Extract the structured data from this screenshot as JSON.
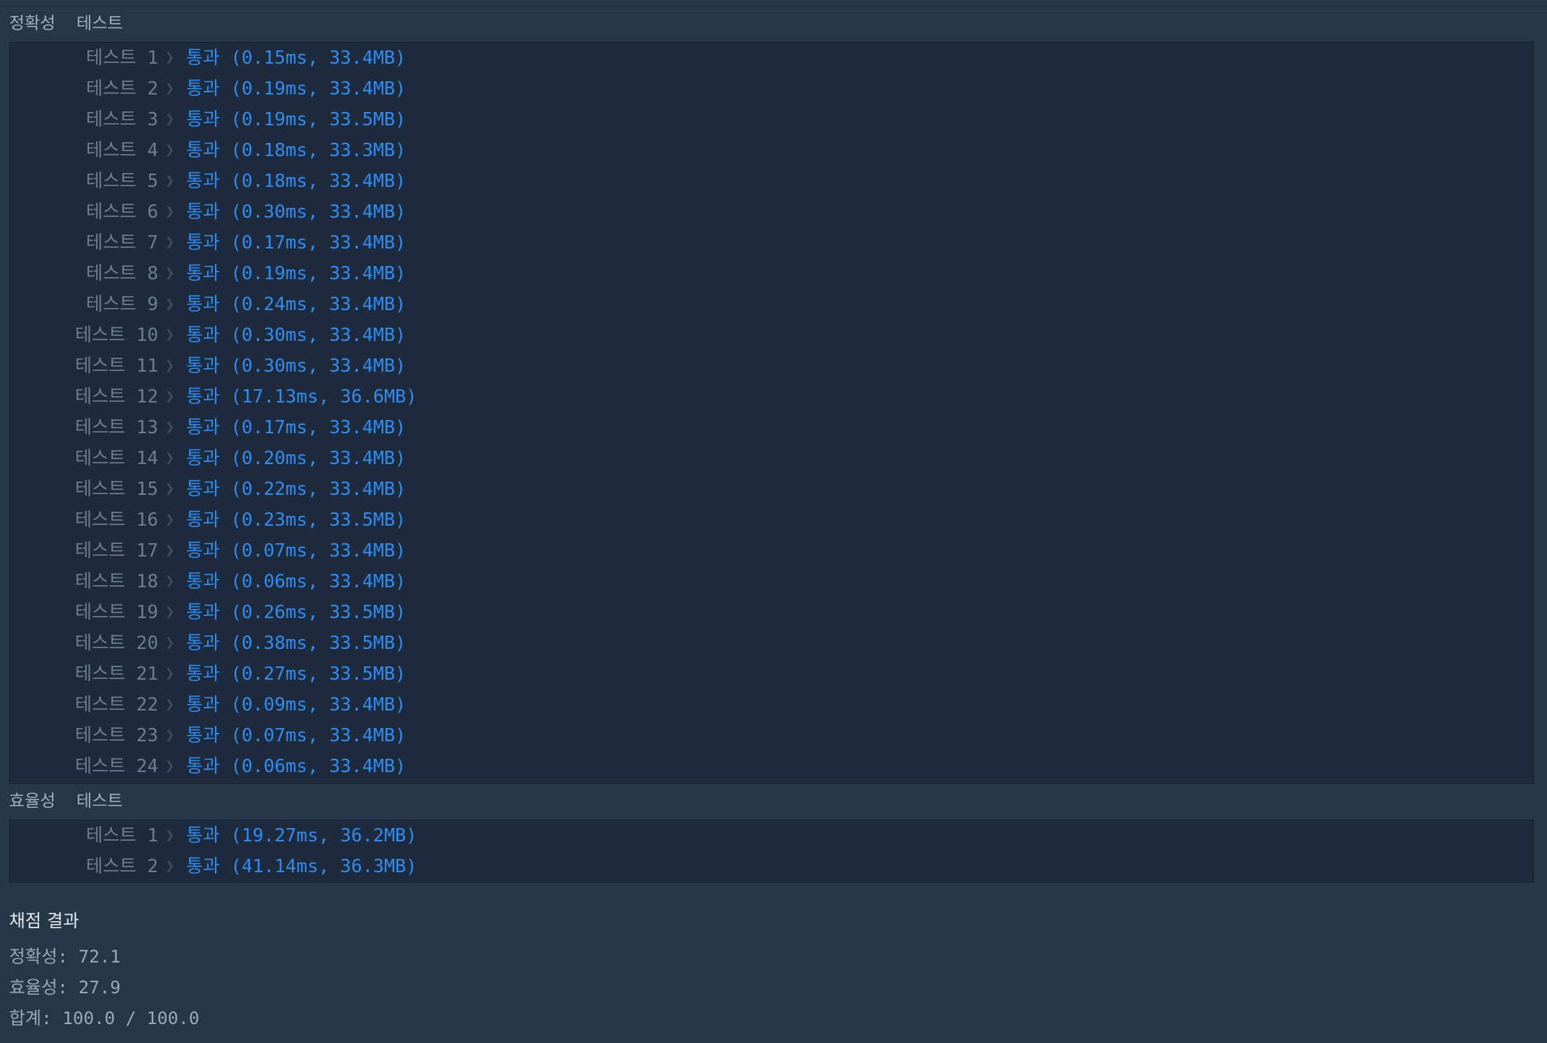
{
  "accuracy_section": {
    "title_part1": "정확성",
    "title_part2": "테스트",
    "rows": [
      {
        "label": "테스트 1",
        "result": "통과 (0.15ms, 33.4MB)"
      },
      {
        "label": "테스트 2",
        "result": "통과 (0.19ms, 33.4MB)"
      },
      {
        "label": "테스트 3",
        "result": "통과 (0.19ms, 33.5MB)"
      },
      {
        "label": "테스트 4",
        "result": "통과 (0.18ms, 33.3MB)"
      },
      {
        "label": "테스트 5",
        "result": "통과 (0.18ms, 33.4MB)"
      },
      {
        "label": "테스트 6",
        "result": "통과 (0.30ms, 33.4MB)"
      },
      {
        "label": "테스트 7",
        "result": "통과 (0.17ms, 33.4MB)"
      },
      {
        "label": "테스트 8",
        "result": "통과 (0.19ms, 33.4MB)"
      },
      {
        "label": "테스트 9",
        "result": "통과 (0.24ms, 33.4MB)"
      },
      {
        "label": "테스트 10",
        "result": "통과 (0.30ms, 33.4MB)"
      },
      {
        "label": "테스트 11",
        "result": "통과 (0.30ms, 33.4MB)"
      },
      {
        "label": "테스트 12",
        "result": "통과 (17.13ms, 36.6MB)"
      },
      {
        "label": "테스트 13",
        "result": "통과 (0.17ms, 33.4MB)"
      },
      {
        "label": "테스트 14",
        "result": "통과 (0.20ms, 33.4MB)"
      },
      {
        "label": "테스트 15",
        "result": "통과 (0.22ms, 33.4MB)"
      },
      {
        "label": "테스트 16",
        "result": "통과 (0.23ms, 33.5MB)"
      },
      {
        "label": "테스트 17",
        "result": "통과 (0.07ms, 33.4MB)"
      },
      {
        "label": "테스트 18",
        "result": "통과 (0.06ms, 33.4MB)"
      },
      {
        "label": "테스트 19",
        "result": "통과 (0.26ms, 33.5MB)"
      },
      {
        "label": "테스트 20",
        "result": "통과 (0.38ms, 33.5MB)"
      },
      {
        "label": "테스트 21",
        "result": "통과 (0.27ms, 33.5MB)"
      },
      {
        "label": "테스트 22",
        "result": "통과 (0.09ms, 33.4MB)"
      },
      {
        "label": "테스트 23",
        "result": "통과 (0.07ms, 33.4MB)"
      },
      {
        "label": "테스트 24",
        "result": "통과 (0.06ms, 33.4MB)"
      }
    ]
  },
  "efficiency_section": {
    "title_part1": "효율성",
    "title_part2": "테스트",
    "rows": [
      {
        "label": "테스트 1",
        "result": "통과 (19.27ms, 36.2MB)"
      },
      {
        "label": "테스트 2",
        "result": "통과 (41.14ms, 36.3MB)"
      }
    ]
  },
  "summary": {
    "heading": "채점 결과",
    "accuracy": "정확성: 72.1",
    "efficiency": "효율성: 27.9",
    "total": "합계: 100.0 / 100.0"
  },
  "icons": {
    "row_separator": "chevron-right-icon"
  },
  "colors": {
    "background": "#263747",
    "panel": "#1e2b3c",
    "pass_text": "#2f8cf2",
    "label_text": "#6d7e91"
  }
}
